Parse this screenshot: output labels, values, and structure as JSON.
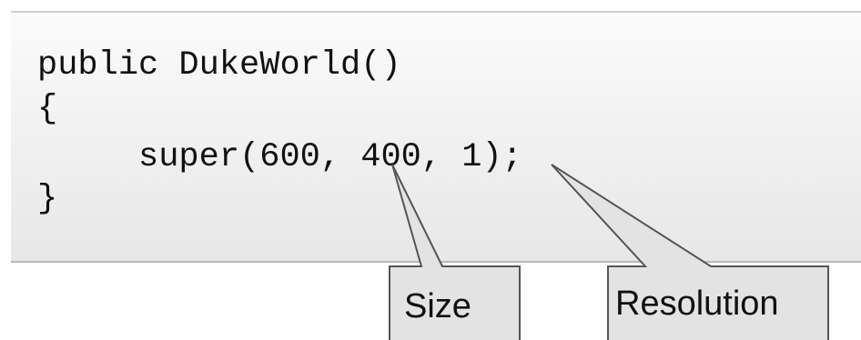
{
  "code": {
    "lines": [
      "public DukeWorld()",
      "{",
      "     super(600, 400, 1);",
      "}"
    ]
  },
  "callouts": {
    "size": "Size",
    "resolution": "Resolution"
  },
  "colors": {
    "text": "#111111",
    "border": "#555555",
    "callout_fill": "#e3e3e3",
    "code_box_fill": "#f2f2f2"
  }
}
